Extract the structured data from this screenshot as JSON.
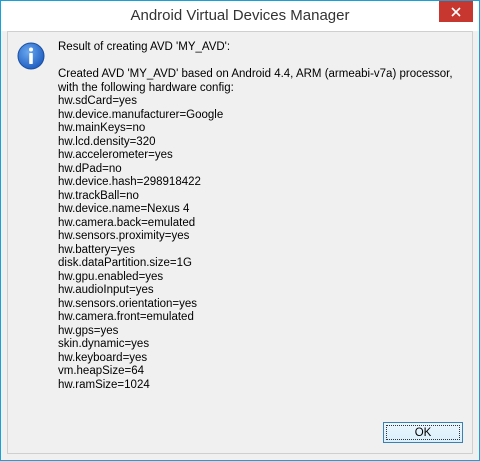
{
  "window": {
    "title": "Android Virtual Devices Manager"
  },
  "dialog": {
    "icon": "info-icon",
    "heading": "Result of creating AVD 'MY_AVD':",
    "message_lines": [
      "Created AVD 'MY_AVD' based on Android 4.4, ARM (armeabi-v7a) processor,",
      "with the following hardware config:",
      "hw.sdCard=yes",
      "hw.device.manufacturer=Google",
      "hw.mainKeys=no",
      "hw.lcd.density=320",
      "hw.accelerometer=yes",
      "hw.dPad=no",
      "hw.device.hash=298918422",
      "hw.trackBall=no",
      "hw.device.name=Nexus 4",
      "hw.camera.back=emulated",
      "hw.sensors.proximity=yes",
      "hw.battery=yes",
      "disk.dataPartition.size=1G",
      "hw.gpu.enabled=yes",
      "hw.audioInput=yes",
      "hw.sensors.orientation=yes",
      "hw.camera.front=emulated",
      "hw.gps=yes",
      "skin.dynamic=yes",
      "hw.keyboard=yes",
      "vm.heapSize=64",
      "hw.ramSize=1024"
    ],
    "ok_label": "OK"
  },
  "colors": {
    "close_button": "#c7372f",
    "info_icon": "#2f6fd0",
    "window_border": "#18a0d8"
  }
}
